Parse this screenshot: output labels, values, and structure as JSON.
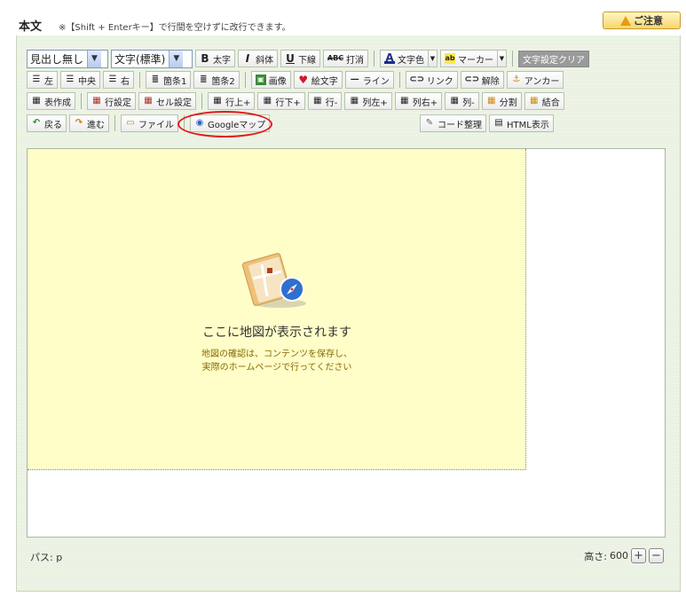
{
  "header": {
    "title": "本文",
    "note": "※【Shift + Enterキー】で行間を空けずに改行できます。",
    "caution_label": "ご注意"
  },
  "toolbar": {
    "row1": {
      "heading_select": "見出し無し",
      "font_select": "文字(標準)",
      "bold": "太字",
      "italic": "斜体",
      "underline": "下線",
      "strike": "打消",
      "text_color": "文字色",
      "marker": "マーカー",
      "clear_format": "文字設定クリア"
    },
    "row2": {
      "align_left": "左",
      "align_center": "中央",
      "align_right": "右",
      "list1": "箇条1",
      "list2": "箇条2",
      "image": "画像",
      "emoji": "絵文字",
      "line": "ライン",
      "link": "リンク",
      "unlink": "解除",
      "anchor": "アンカー"
    },
    "row3": {
      "table_create": "表作成",
      "row_settings": "行設定",
      "cell_settings": "セル設定",
      "row_above": "行上+",
      "row_below": "行下+",
      "row_delete": "行-",
      "col_left": "列左+",
      "col_right": "列右+",
      "col_delete": "列-",
      "split": "分割",
      "merge": "結合"
    },
    "row4": {
      "back": "戻る",
      "forward": "進む",
      "file": "ファイル",
      "google_map": "Googleマップ",
      "code_cleanup": "コード整理",
      "html_view": "HTML表示"
    }
  },
  "editor": {
    "map_placeholder": "ここに地図が表示されます",
    "map_note_line1": "地図の確認は、コンテンツを保存し、",
    "map_note_line2": "実際のホームページで行ってください"
  },
  "status": {
    "path": "パス: p",
    "height_label": "高さ:",
    "height_value": "600"
  },
  "colors": {
    "highlight_circle": "#e21818",
    "map_background": "#fffdc8",
    "caution_bg": "#f7d66a"
  }
}
